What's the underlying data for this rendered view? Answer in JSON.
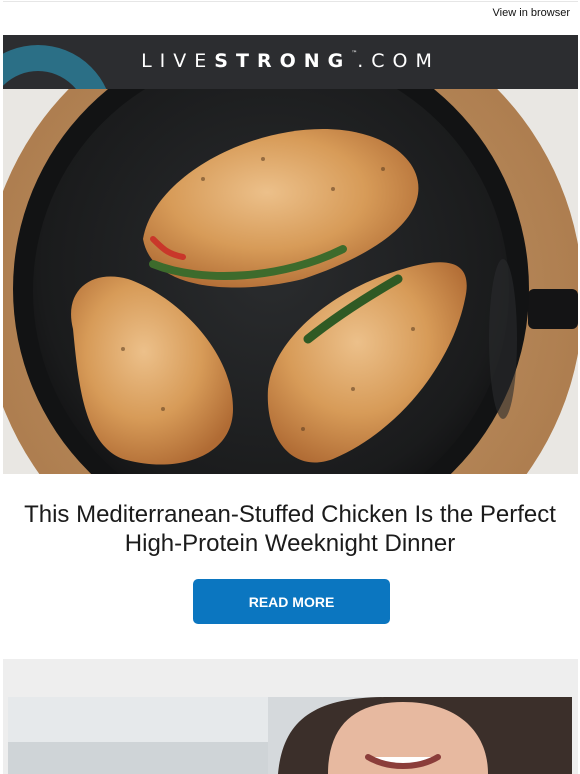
{
  "header_links": {
    "view_in_browser": "View in browser"
  },
  "brand": {
    "name_light": "LIVE",
    "name_bold": "STRONG",
    "trademark": "™",
    "suffix": ".COM"
  },
  "article": {
    "hero_alt": "chicken-breasts-in-skillet-image",
    "title": "This Mediterranean-Stuffed Chicken Is the Perfect High-Protein Weeknight Dinner",
    "cta_label": "READ MORE"
  },
  "colors": {
    "header_bg": "#2c2d30",
    "accent_ring": "#2b6f86",
    "cta_bg": "#0b76c0",
    "section_bg": "#eeeeee"
  }
}
